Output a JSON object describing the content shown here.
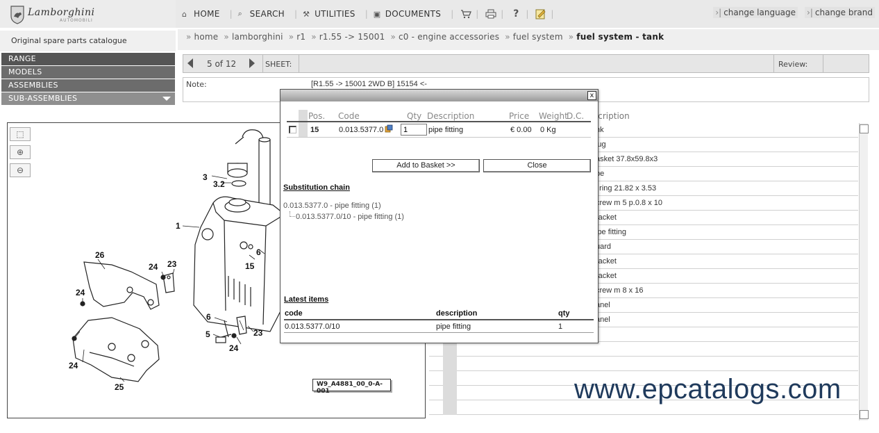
{
  "brand": {
    "logo_text": "Lamborghini",
    "logo_sub": "AUTOMOBILI"
  },
  "nav": {
    "home": "HOME",
    "search": "SEARCH",
    "utilities": "UTILITIES",
    "documents": "DOCUMENTS"
  },
  "top_links": {
    "change_language": "change language",
    "change_brand": "change brand"
  },
  "sidebar": {
    "title": "Original spare parts catalogue",
    "items": [
      {
        "label": "RANGE"
      },
      {
        "label": "MODELS"
      },
      {
        "label": "ASSEMBLIES"
      },
      {
        "label": "SUB-ASSEMBLIES"
      }
    ]
  },
  "breadcrumb": {
    "items": [
      "home",
      "lamborghini",
      "r1",
      "r1.55 -> 15001",
      "c0 - engine accessories",
      "fuel system"
    ],
    "current": "fuel system - tank"
  },
  "pager": {
    "text": "5 of 12",
    "sheet_label": "SHEET:",
    "review_label": "Review:"
  },
  "note": {
    "label": "Note:",
    "value": "[R1.55 -> 15001 2WD B] 15154 <-"
  },
  "drawing": {
    "reference": "W9_A4881_00_0-A-001",
    "callouts": [
      "1",
      "3",
      "3.2",
      "26",
      "24",
      "23",
      "6",
      "15",
      "24",
      "6",
      "5",
      "23",
      "24",
      "24",
      "25"
    ]
  },
  "parts_list": {
    "header": "scription",
    "rows": [
      "nk",
      "lug",
      "asket 37.8x59.8x3",
      "be",
      "' ring 21.82 x 3.53",
      "crew m 5 p.0.8 x 10",
      "racket",
      "ipe fitting",
      "uard",
      "racket",
      "racket",
      "crew m 8 x 16",
      "anel",
      "anel",
      "",
      "",
      "",
      "",
      "",
      ""
    ]
  },
  "popup": {
    "close_glyph": "x",
    "columns": {
      "pos": "Pos.",
      "code": "Code",
      "qty": "Qty",
      "description": "Description",
      "price": "Price",
      "weight": "Weight",
      "dc": "D.C."
    },
    "row": {
      "pos": "15",
      "code": "0.013.5377.0",
      "qty": "1",
      "description": "pipe fitting",
      "price": "€ 0.00",
      "weight": "0 Kg"
    },
    "add_to_basket": "Add to Basket >>",
    "close": "Close",
    "substitution_title": "Substitution chain",
    "chain": [
      "0.013.5377.0 - pipe fitting (1)",
      "0.013.5377.0/10 - pipe fitting (1)"
    ],
    "latest_title": "Latest items",
    "latest_headers": {
      "code": "code",
      "description": "description",
      "qty": "qty"
    },
    "latest_rows": [
      {
        "code": "0.013.5377.0/10",
        "description": "pipe fitting",
        "qty": "1"
      }
    ]
  },
  "watermark": "www.epcatalogs.com"
}
